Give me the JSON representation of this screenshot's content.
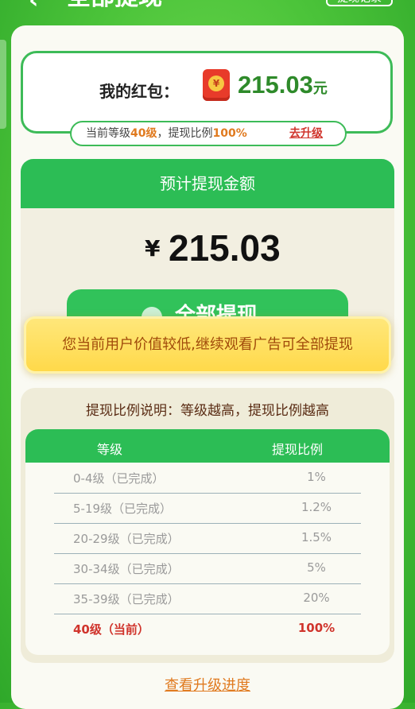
{
  "header": {
    "title": "全部提现",
    "record_label": "提现记录"
  },
  "redpacket": {
    "label": "我的红包：",
    "icon_glyph": "¥",
    "amount": "215.03",
    "unit": "元"
  },
  "level_info": {
    "prefix": "当前等级",
    "level": "40级",
    "mid": "，提现比例",
    "ratio": "100%",
    "upgrade_link": "去升级"
  },
  "withdraw": {
    "header": "预计提现金额",
    "currency": "¥",
    "amount": "215.03",
    "button_label": "全部提现"
  },
  "notice": {
    "text": "您当前用户价值较低,继续观看广告可全部提现"
  },
  "ratio_section": {
    "title": "提现比例说明：等级越高，提现比例越高",
    "columns": [
      "等级",
      "提现比例"
    ],
    "rows": [
      {
        "level": "0-4级（已完成）",
        "ratio": "1%"
      },
      {
        "level": "5-19级（已完成）",
        "ratio": "1.2%"
      },
      {
        "level": "20-29级（已完成）",
        "ratio": "1.5%"
      },
      {
        "level": "30-34级（已完成）",
        "ratio": "5%"
      },
      {
        "level": "35-39级（已完成）",
        "ratio": "20%"
      },
      {
        "level": "40级（当前）",
        "ratio": "100%"
      }
    ]
  },
  "footer": {
    "progress_link": "查看升级进度"
  },
  "colors": {
    "accent_green": "#2cbd55",
    "current_red": "#d0342c",
    "link_orange": "#e07a1f"
  }
}
